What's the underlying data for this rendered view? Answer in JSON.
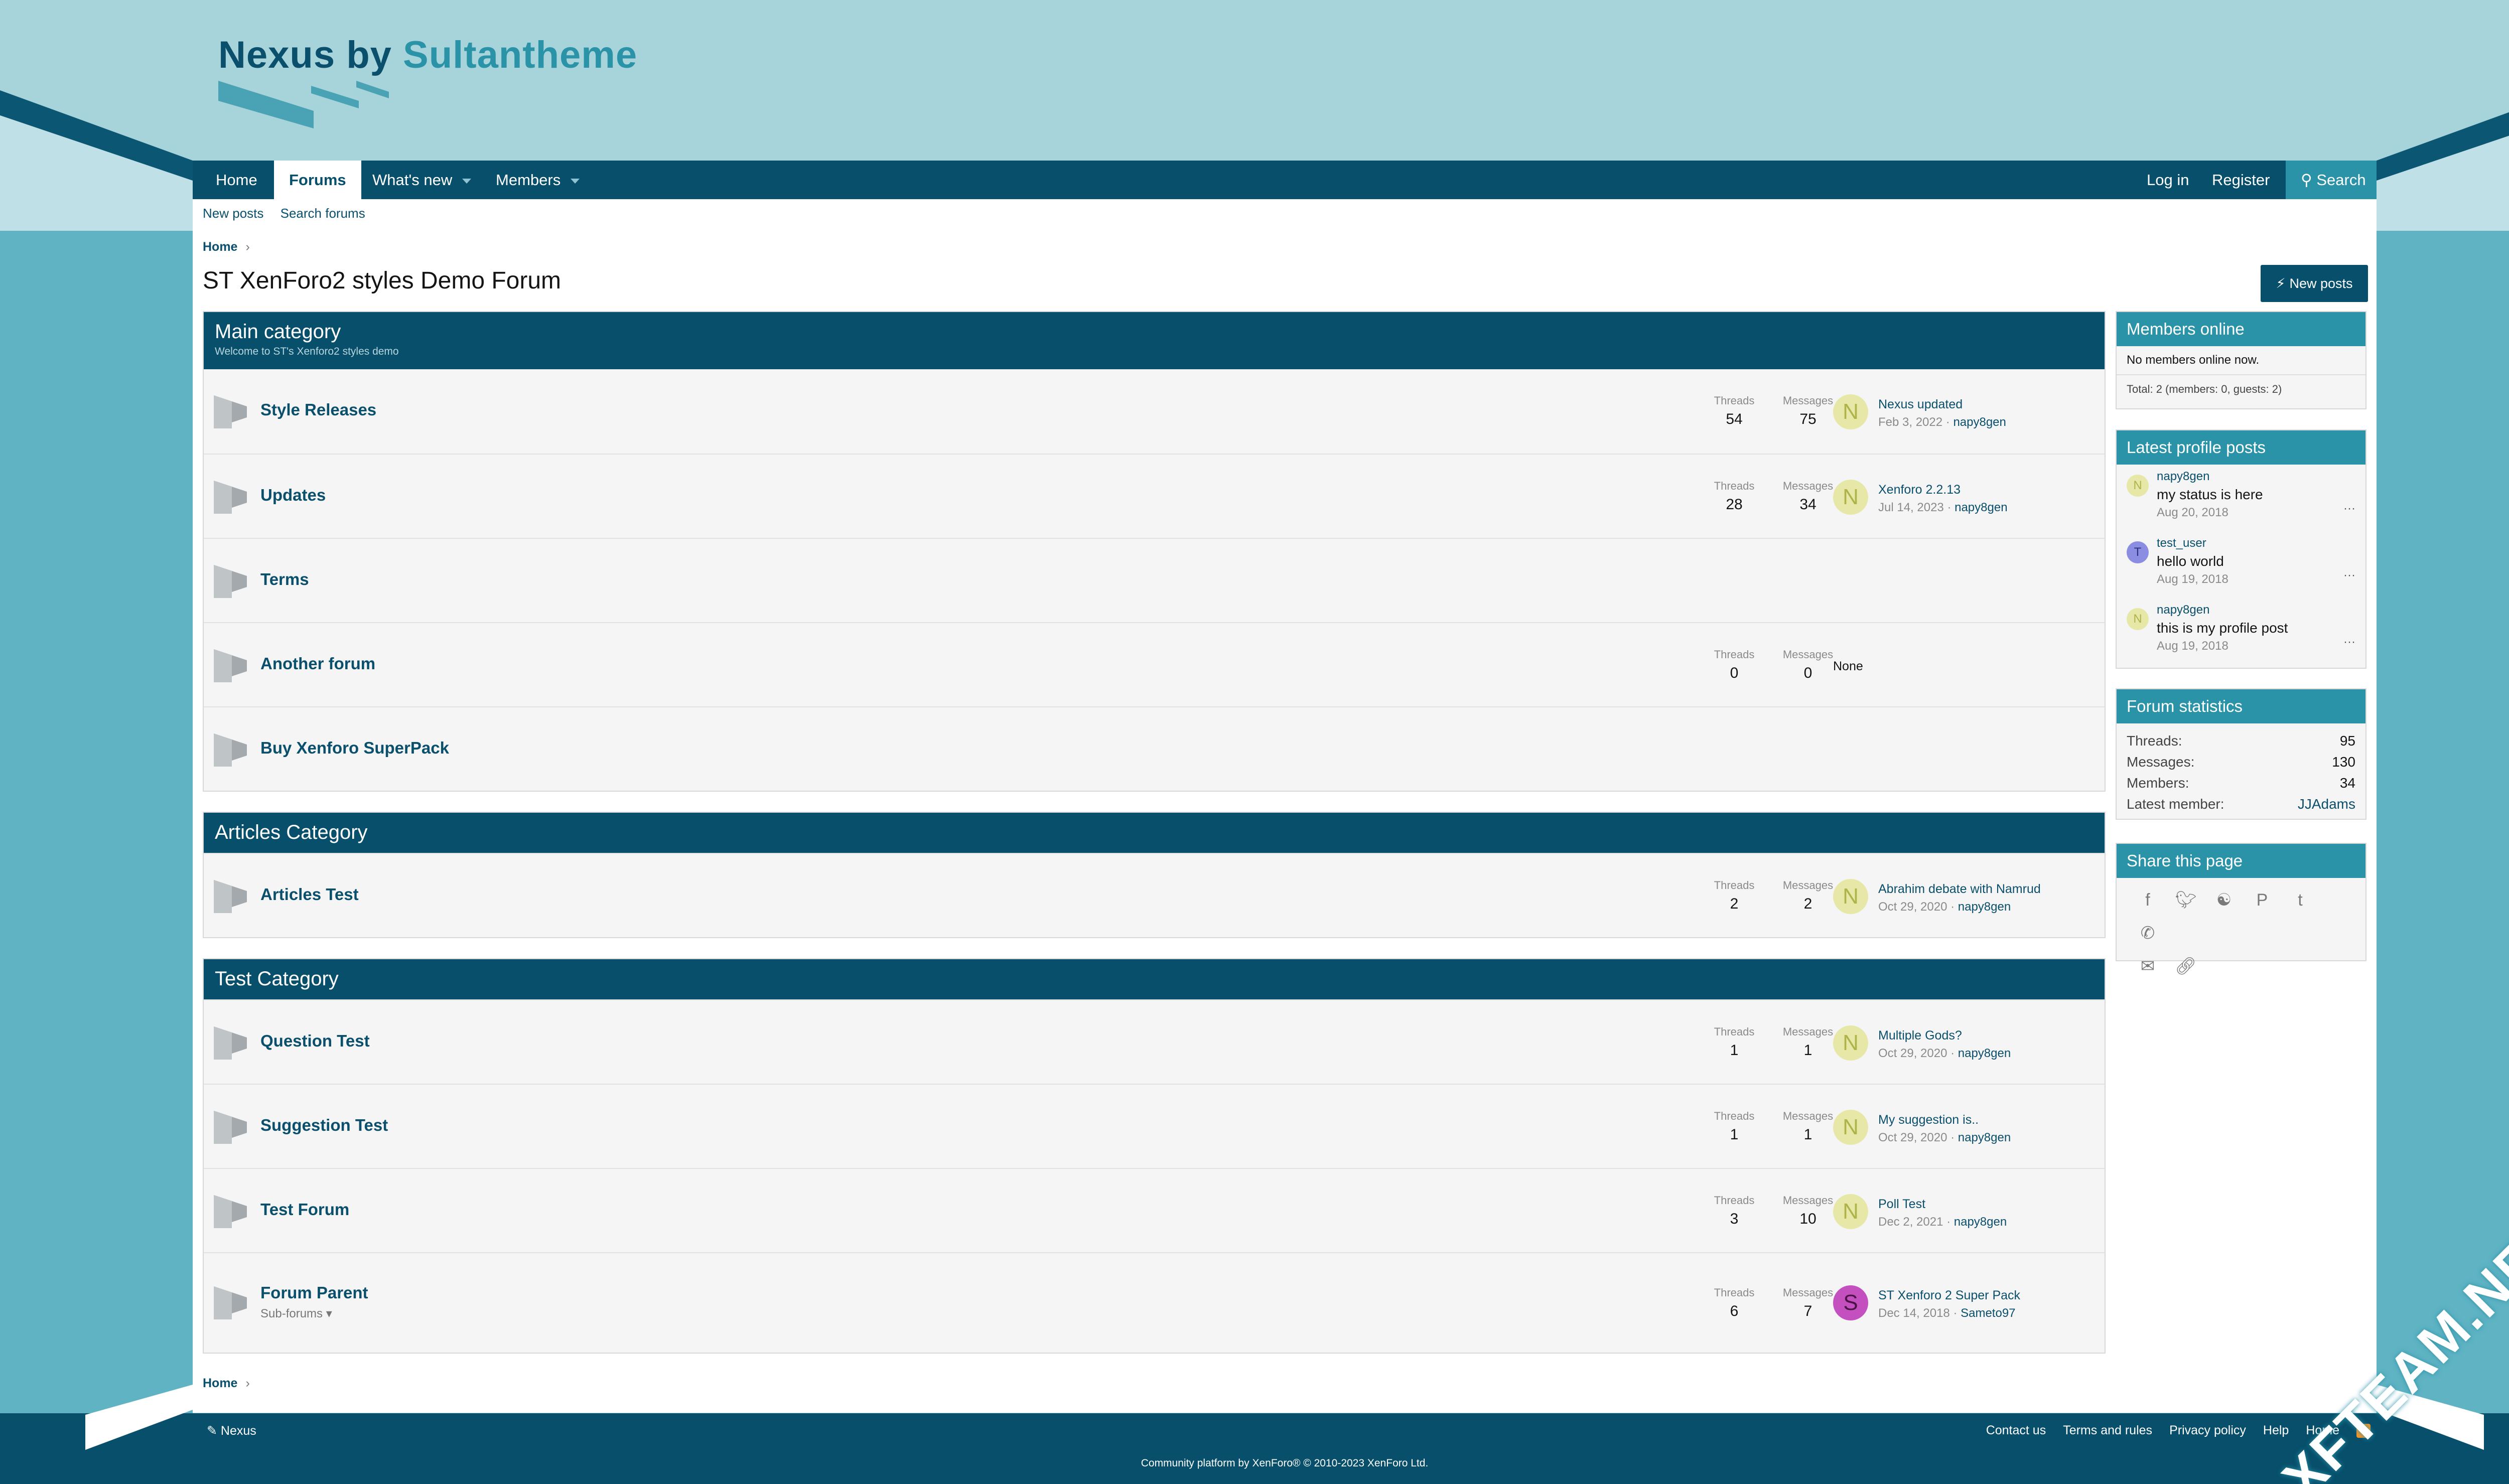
{
  "brand": {
    "name_part1": "Nexus by ",
    "name_part2": "Sultantheme"
  },
  "nav": {
    "tabs": [
      {
        "label": "Home"
      },
      {
        "label": "Forums"
      },
      {
        "label": "What's new"
      },
      {
        "label": "Members"
      }
    ],
    "login": "Log in",
    "register": "Register",
    "search": "Search"
  },
  "subnav": {
    "new_posts": "New posts",
    "search_forums": "Search forums"
  },
  "breadcrumb": {
    "home": "Home"
  },
  "page_title": "ST XenForo2 styles Demo Forum",
  "new_posts_button": "New posts",
  "labels": {
    "threads": "Threads",
    "messages": "Messages",
    "none": "None"
  },
  "categories": [
    {
      "title": "Main category",
      "description": "Welcome to ST's Xenforo2 styles demo",
      "nodes": [
        {
          "title": "Style Releases",
          "threads": "54",
          "messages": "75",
          "avatar": "N",
          "last_title": "Nexus updated",
          "last_date": "Feb 3, 2022",
          "last_user": "napy8gen"
        },
        {
          "title": "Updates",
          "threads": "28",
          "messages": "34",
          "avatar": "N",
          "last_title": "Xenforo 2.2.13",
          "last_date": "Jul 14, 2023",
          "last_user": "napy8gen"
        },
        {
          "title": "Terms"
        },
        {
          "title": "Another forum",
          "threads": "0",
          "messages": "0"
        },
        {
          "title": "Buy Xenforo SuperPack"
        }
      ]
    },
    {
      "title": "Articles Category",
      "nodes": [
        {
          "title": "Articles Test",
          "threads": "2",
          "messages": "2",
          "avatar": "N",
          "last_title": "Abrahim debate with Namrud",
          "last_date": "Oct 29, 2020",
          "last_user": "napy8gen"
        }
      ]
    },
    {
      "title": "Test Category",
      "nodes": [
        {
          "title": "Question Test",
          "threads": "1",
          "messages": "1",
          "avatar": "N",
          "last_title": "Multiple Gods?",
          "last_date": "Oct 29, 2020",
          "last_user": "napy8gen"
        },
        {
          "title": "Suggestion Test",
          "threads": "1",
          "messages": "1",
          "avatar": "N",
          "last_title": "My suggestion is..",
          "last_date": "Oct 29, 2020",
          "last_user": "napy8gen"
        },
        {
          "title": "Test Forum",
          "threads": "3",
          "messages": "10",
          "avatar": "N",
          "last_title": "Poll Test",
          "last_date": "Dec 2, 2021",
          "last_user": "napy8gen"
        },
        {
          "title": "Forum Parent",
          "subforums": "Sub-forums",
          "threads": "6",
          "messages": "7",
          "avatar": "S",
          "last_title": "ST Xenforo 2 Super Pack",
          "last_date": "Dec 14, 2018",
          "last_user": "Sameto97"
        }
      ]
    }
  ],
  "sidebar": {
    "members_online": {
      "title": "Members online",
      "text": "No members online now.",
      "total": "Total: 2 (members: 0, guests: 2)"
    },
    "profile_posts": {
      "title": "Latest profile posts",
      "posts": [
        {
          "avatar": "N",
          "user": "napy8gen",
          "text": "my status is here",
          "date": "Aug 20, 2018"
        },
        {
          "avatar": "T",
          "user": "test_user",
          "text": "hello world",
          "date": "Aug 19, 2018"
        },
        {
          "avatar": "N",
          "user": "napy8gen",
          "text": "this is my profile post",
          "date": "Aug 19, 2018"
        }
      ]
    },
    "forum_stats": {
      "title": "Forum statistics",
      "rows": [
        {
          "label": "Threads:",
          "value": "95"
        },
        {
          "label": "Messages:",
          "value": "130"
        },
        {
          "label": "Members:",
          "value": "34"
        },
        {
          "label": "Latest member:",
          "value": "JJAdams"
        }
      ]
    },
    "share": {
      "title": "Share this page",
      "icons": [
        "facebook-icon",
        "twitter-icon",
        "reddit-icon",
        "pinterest-icon",
        "tumblr-icon",
        "whatsapp-icon",
        "email-icon",
        "link-icon"
      ]
    }
  },
  "footer": {
    "style_name": "Nexus",
    "links": [
      "Contact us",
      "Terms and rules",
      "Privacy policy",
      "Help",
      "Home"
    ],
    "copyright": "Community platform by XenForo® © 2010-2023 XenForo Ltd."
  },
  "watermark": "XFTEAM.NET",
  "colors": {
    "primary": "#074f6b",
    "accent": "#2b93a8",
    "background": "#a7d3da",
    "link": "#0a4f6b"
  }
}
